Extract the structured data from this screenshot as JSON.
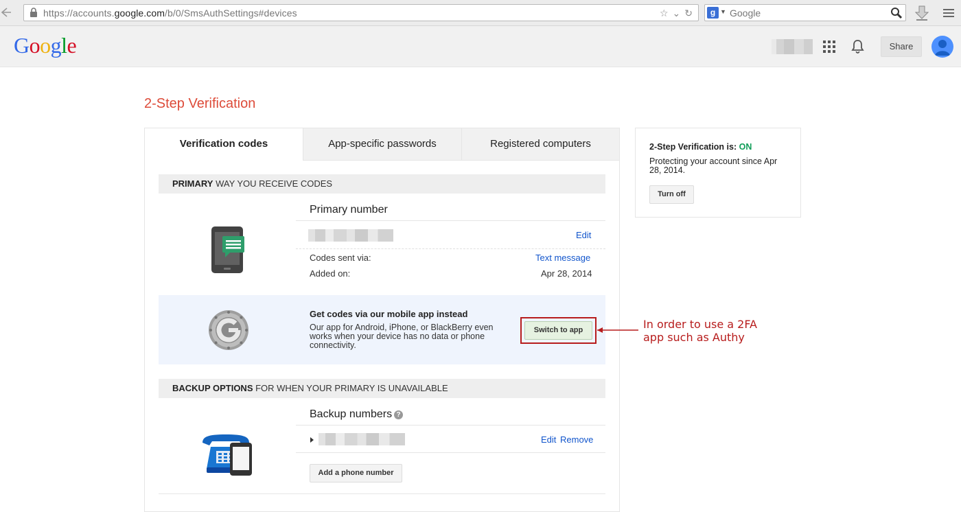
{
  "browser": {
    "url_prefix": "https://accounts.",
    "url_host": "google.com",
    "url_path": "/b/0/SmsAuthSettings#devices",
    "search_placeholder": "Google",
    "search_engine_letter": "g"
  },
  "header": {
    "logo_letters": [
      "G",
      "o",
      "o",
      "g",
      "l",
      "e"
    ],
    "share_label": "Share"
  },
  "page": {
    "title": "2-Step Verification",
    "tabs": [
      "Verification codes",
      "App-specific passwords",
      "Registered computers"
    ],
    "primary_section": {
      "bold": "PRIMARY",
      "rest": " WAY YOU RECEIVE CODES"
    },
    "primary_number": {
      "heading": "Primary number",
      "edit_label": "Edit",
      "codes_sent_label": "Codes sent via:",
      "codes_sent_value": "Text message",
      "added_label": "Added on:",
      "added_value": "Apr 28, 2014"
    },
    "app_promo": {
      "title": "Get codes via our mobile app instead",
      "description": "Our app for Android, iPhone, or BlackBerry even works when your device has no data or phone connectivity.",
      "button_label": "Switch to app"
    },
    "backup_section": {
      "bold": "BACKUP OPTIONS",
      "rest": " FOR WHEN YOUR PRIMARY IS UNAVAILABLE"
    },
    "backup": {
      "heading": "Backup numbers",
      "help_glyph": "?",
      "edit_label": "Edit",
      "remove_label": "Remove",
      "add_button_label": "Add a phone number"
    }
  },
  "status": {
    "label": "2-Step Verification is: ",
    "value": "ON",
    "value_color": "#0f9d58",
    "description": "Protecting your account since Apr 28, 2014.",
    "turn_off_label": "Turn off"
  },
  "annotation": {
    "text": "In order to use a 2FA app such as Authy",
    "color": "#b71c1c"
  }
}
